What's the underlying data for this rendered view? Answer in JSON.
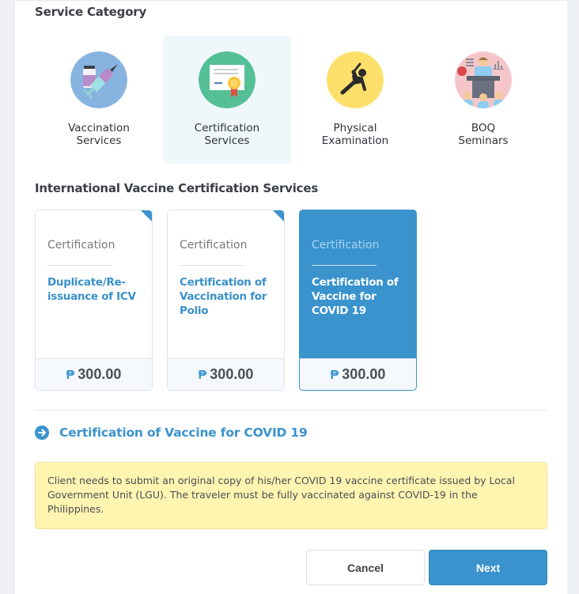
{
  "service_category": {
    "title": "Service Category",
    "items": [
      {
        "label": "Vaccination\nServices",
        "icon": "vaccine-syringe-icon",
        "icon_bg": "#86b3e0",
        "selected": false
      },
      {
        "label": "Certification\nServices",
        "icon": "certificate-icon",
        "icon_bg": "#55bf96",
        "selected": true
      },
      {
        "label": "Physical\nExamination",
        "icon": "stretching-person-icon",
        "icon_bg": "#fde06b",
        "selected": false
      },
      {
        "label": "BOQ\nSeminars",
        "icon": "seminar-speaker-icon",
        "icon_bg": "#f5c6c9",
        "selected": false
      }
    ]
  },
  "services": {
    "title": "International Vaccine Certification Services",
    "cards": [
      {
        "category": "Certification",
        "name": "Duplicate/Re-\nissuance of ICV",
        "currency": "₱",
        "price": "300.00",
        "selected": false
      },
      {
        "category": "Certification",
        "name": "Certification of\nVaccination for\nPolio",
        "currency": "₱",
        "price": "300.00",
        "selected": false
      },
      {
        "category": "Certification",
        "name": "Certification of\nVaccine for\nCOVID 19",
        "currency": "₱",
        "price": "300.00",
        "selected": true
      }
    ]
  },
  "selected_service": {
    "title": "Certification of Vaccine for COVID 19",
    "icon": "arrow-right-circle-icon",
    "notice": "Client needs to submit an original copy of his/her COVID 19 vaccine certificate issued by Local Government Unit (LGU). The traveler must be fully vaccinated against COVID-19 in the Philippines."
  },
  "actions": {
    "cancel_label": "Cancel",
    "next_label": "Next"
  },
  "colors": {
    "accent": "#3a93cd",
    "notice_bg": "#fff5b1",
    "selected_category_bg": "#eef8fa",
    "page_bg": "#eff0f4"
  }
}
